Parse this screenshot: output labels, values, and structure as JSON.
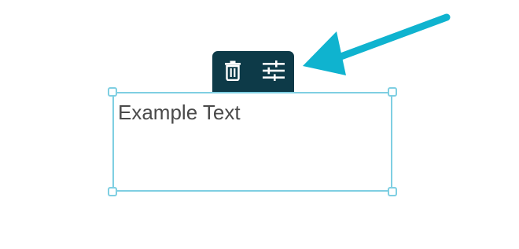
{
  "text_box": {
    "text": "Example Text"
  },
  "toolbar": {
    "delete_icon": "trash-icon",
    "settings_icon": "sliders-icon"
  },
  "colors": {
    "toolbar_bg": "#0d3a48",
    "selection_border": "#7fcfe2",
    "arrow": "#0fb3cf",
    "text": "#4a4a4a"
  }
}
